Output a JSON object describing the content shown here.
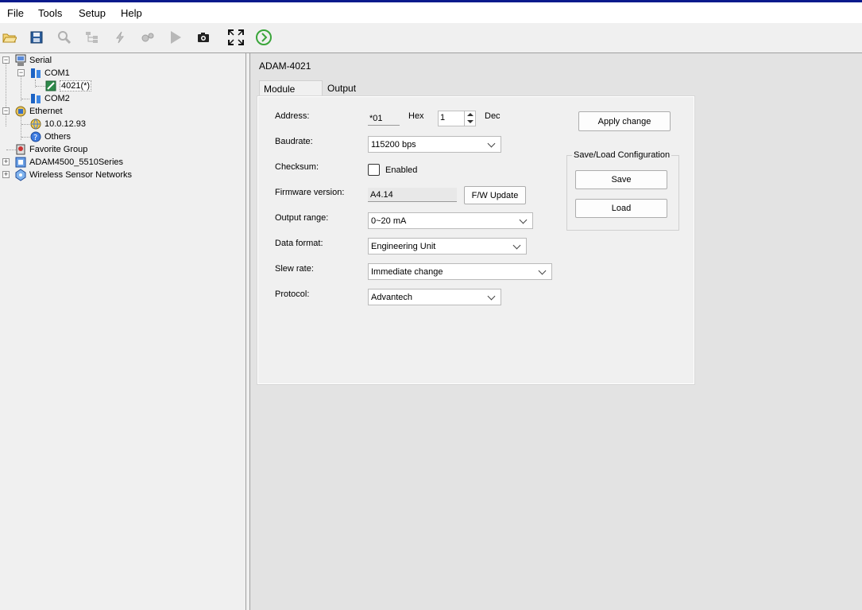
{
  "menu": [
    "File",
    "Tools",
    "Setup",
    "Help"
  ],
  "toolbar_icons": [
    "open-folder-icon",
    "save-disk-icon",
    "search-icon",
    "network-tree-icon",
    "flash-icon",
    "gears-icon",
    "play-icon",
    "camera-icon",
    "fullscreen-icon",
    "refresh-icon"
  ],
  "tree": {
    "serial": "Serial",
    "com1": "COM1",
    "module": "4021(*)",
    "com2": "COM2",
    "ethernet": "Ethernet",
    "ip": "10.0.12.93",
    "others": "Others",
    "favorite": "Favorite Group",
    "adam4500": "ADAM4500_5510Series",
    "wsn": "Wireless Sensor Networks"
  },
  "module_title": "ADAM-4021",
  "tabs": [
    "Module setting",
    "Output"
  ],
  "form": {
    "address_label": "Address:",
    "address_hex": "*01",
    "hex_label": "Hex",
    "address_dec": "1",
    "dec_label": "Dec",
    "baudrate_label": "Baudrate:",
    "baudrate": "115200 bps",
    "checksum_label": "Checksum:",
    "checksum_text": "Enabled",
    "checksum_checked": false,
    "firmware_label": "Firmware version:",
    "firmware": "A4.14",
    "fw_update": "F/W Update",
    "output_range_label": "Output range:",
    "output_range": "0~20 mA",
    "data_format_label": "Data format:",
    "data_format": "Engineering Unit",
    "slew_rate_label": "Slew rate:",
    "slew_rate": "Immediate change",
    "protocol_label": "Protocol:",
    "protocol": "Advantech"
  },
  "apply_change": "Apply change",
  "save_load": {
    "title": "Save/Load Configuration",
    "save": "Save",
    "load": "Load"
  }
}
